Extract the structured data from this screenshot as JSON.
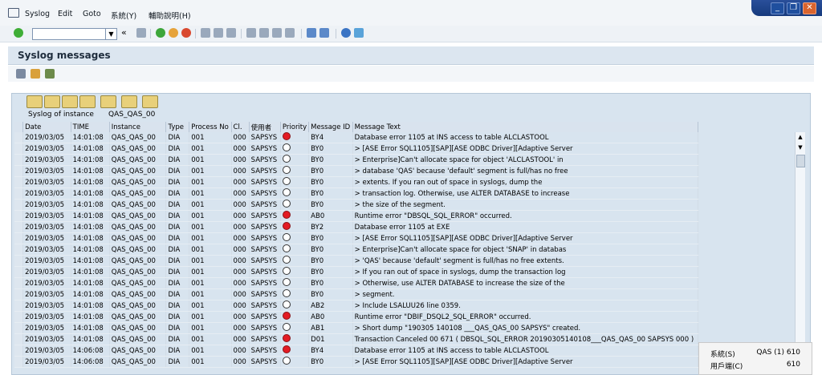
{
  "menu": {
    "items": [
      {
        "label": "Syslog"
      },
      {
        "label": "Edit"
      },
      {
        "label": "Goto"
      },
      {
        "label": "系統(Y)"
      },
      {
        "label": "輔助說明(H)"
      }
    ]
  },
  "window": {
    "minimize": "_",
    "restore": "❐",
    "close": "✕"
  },
  "toolbar": {
    "command_value": "",
    "back_symbol": "«"
  },
  "page": {
    "title": "Syslog messages"
  },
  "panel": {
    "instance_label": "Syslog of instance",
    "instance_value": "QAS_QAS_00"
  },
  "table": {
    "columns": [
      "Date",
      "TIME",
      "Instance",
      "Type",
      "Process No",
      "Cl.",
      "使用者",
      "Priority",
      "Message ID",
      "Message Text"
    ],
    "rows": [
      {
        "date": "2019/03/05",
        "time": "14:01:08",
        "instance": "QAS_QAS_00",
        "type": "DIA",
        "proc": "001",
        "cl": "000",
        "user": "SAPSYS",
        "priority": "red",
        "msgid": "BY4",
        "text": "Database error 1105 at INS access to table ALCLASTOOL"
      },
      {
        "date": "2019/03/05",
        "time": "14:01:08",
        "instance": "QAS_QAS_00",
        "type": "DIA",
        "proc": "001",
        "cl": "000",
        "user": "SAPSYS",
        "priority": "empty",
        "msgid": "BY0",
        "text": "> [ASE Error SQL1105][SAP][ASE ODBC Driver][Adaptive Server"
      },
      {
        "date": "2019/03/05",
        "time": "14:01:08",
        "instance": "QAS_QAS_00",
        "type": "DIA",
        "proc": "001",
        "cl": "000",
        "user": "SAPSYS",
        "priority": "empty",
        "msgid": "BY0",
        "text": "> Enterprise]Can't allocate space for object 'ALCLASTOOL' in"
      },
      {
        "date": "2019/03/05",
        "time": "14:01:08",
        "instance": "QAS_QAS_00",
        "type": "DIA",
        "proc": "001",
        "cl": "000",
        "user": "SAPSYS",
        "priority": "empty",
        "msgid": "BY0",
        "text": "> database 'QAS' because 'default' segment is full/has no free"
      },
      {
        "date": "2019/03/05",
        "time": "14:01:08",
        "instance": "QAS_QAS_00",
        "type": "DIA",
        "proc": "001",
        "cl": "000",
        "user": "SAPSYS",
        "priority": "empty",
        "msgid": "BY0",
        "text": "> extents. If you ran out of space in syslogs, dump the"
      },
      {
        "date": "2019/03/05",
        "time": "14:01:08",
        "instance": "QAS_QAS_00",
        "type": "DIA",
        "proc": "001",
        "cl": "000",
        "user": "SAPSYS",
        "priority": "empty",
        "msgid": "BY0",
        "text": "> transaction log. Otherwise, use ALTER DATABASE to increase"
      },
      {
        "date": "2019/03/05",
        "time": "14:01:08",
        "instance": "QAS_QAS_00",
        "type": "DIA",
        "proc": "001",
        "cl": "000",
        "user": "SAPSYS",
        "priority": "empty",
        "msgid": "BY0",
        "text": "> the size of the segment."
      },
      {
        "date": "2019/03/05",
        "time": "14:01:08",
        "instance": "QAS_QAS_00",
        "type": "DIA",
        "proc": "001",
        "cl": "000",
        "user": "SAPSYS",
        "priority": "red",
        "msgid": "AB0",
        "text": "Runtime error \"DBSQL_SQL_ERROR\" occurred."
      },
      {
        "date": "2019/03/05",
        "time": "14:01:08",
        "instance": "QAS_QAS_00",
        "type": "DIA",
        "proc": "001",
        "cl": "000",
        "user": "SAPSYS",
        "priority": "red",
        "msgid": "BY2",
        "text": "Database error 1105 at EXE"
      },
      {
        "date": "2019/03/05",
        "time": "14:01:08",
        "instance": "QAS_QAS_00",
        "type": "DIA",
        "proc": "001",
        "cl": "000",
        "user": "SAPSYS",
        "priority": "empty",
        "msgid": "BY0",
        "text": "> [ASE Error SQL1105][SAP][ASE ODBC Driver][Adaptive Server"
      },
      {
        "date": "2019/03/05",
        "time": "14:01:08",
        "instance": "QAS_QAS_00",
        "type": "DIA",
        "proc": "001",
        "cl": "000",
        "user": "SAPSYS",
        "priority": "empty",
        "msgid": "BY0",
        "text": "> Enterprise]Can't allocate space for object 'SNAP' in databas"
      },
      {
        "date": "2019/03/05",
        "time": "14:01:08",
        "instance": "QAS_QAS_00",
        "type": "DIA",
        "proc": "001",
        "cl": "000",
        "user": "SAPSYS",
        "priority": "empty",
        "msgid": "BY0",
        "text": "> 'QAS' because 'default' segment is full/has no free extents."
      },
      {
        "date": "2019/03/05",
        "time": "14:01:08",
        "instance": "QAS_QAS_00",
        "type": "DIA",
        "proc": "001",
        "cl": "000",
        "user": "SAPSYS",
        "priority": "empty",
        "msgid": "BY0",
        "text": "> If you ran out of space in syslogs, dump the transaction log"
      },
      {
        "date": "2019/03/05",
        "time": "14:01:08",
        "instance": "QAS_QAS_00",
        "type": "DIA",
        "proc": "001",
        "cl": "000",
        "user": "SAPSYS",
        "priority": "empty",
        "msgid": "BY0",
        "text": "> Otherwise, use ALTER DATABASE to increase the size of the"
      },
      {
        "date": "2019/03/05",
        "time": "14:01:08",
        "instance": "QAS_QAS_00",
        "type": "DIA",
        "proc": "001",
        "cl": "000",
        "user": "SAPSYS",
        "priority": "empty",
        "msgid": "BY0",
        "text": "> segment."
      },
      {
        "date": "2019/03/05",
        "time": "14:01:08",
        "instance": "QAS_QAS_00",
        "type": "DIA",
        "proc": "001",
        "cl": "000",
        "user": "SAPSYS",
        "priority": "empty",
        "msgid": "AB2",
        "text": "> Include LSALUU26 line 0359."
      },
      {
        "date": "2019/03/05",
        "time": "14:01:08",
        "instance": "QAS_QAS_00",
        "type": "DIA",
        "proc": "001",
        "cl": "000",
        "user": "SAPSYS",
        "priority": "red",
        "msgid": "AB0",
        "text": "Runtime error \"DBIF_DSQL2_SQL_ERROR\" occurred."
      },
      {
        "date": "2019/03/05",
        "time": "14:01:08",
        "instance": "QAS_QAS_00",
        "type": "DIA",
        "proc": "001",
        "cl": "000",
        "user": "SAPSYS",
        "priority": "empty",
        "msgid": "AB1",
        "text": "> Short dump \"190305 140108 ___QAS_QAS_00 SAPSYS\" created."
      },
      {
        "date": "2019/03/05",
        "time": "14:01:08",
        "instance": "QAS_QAS_00",
        "type": "DIA",
        "proc": "001",
        "cl": "000",
        "user": "SAPSYS",
        "priority": "red",
        "msgid": "D01",
        "text": "Transaction Canceled 00 671 ( DBSQL_SQL_ERROR 20190305140108___QAS_QAS_00 SAPSYS 000 )"
      },
      {
        "date": "2019/03/05",
        "time": "14:06:08",
        "instance": "QAS_QAS_00",
        "type": "DIA",
        "proc": "001",
        "cl": "000",
        "user": "SAPSYS",
        "priority": "red",
        "msgid": "BY4",
        "text": "Database error 1105 at INS access to table ALCLASTOOL"
      },
      {
        "date": "2019/03/05",
        "time": "14:06:08",
        "instance": "QAS_QAS_00",
        "type": "DIA",
        "proc": "001",
        "cl": "000",
        "user": "SAPSYS",
        "priority": "empty",
        "msgid": "BY0",
        "text": "> [ASE Error SQL1105][SAP][ASE ODBC Driver][Adaptive Server"
      }
    ]
  },
  "status": {
    "system_label": "系統(S)",
    "system_value": "QAS (1) 610",
    "client_label": "用戶端(C)",
    "client_value": "610"
  },
  "colors": {
    "header_bg": "#dce6f0",
    "panel_bg": "#d8e4ef",
    "priority_red": "#e31b23"
  },
  "icons": [
    "menu-icon",
    "check-icon",
    "save-icon",
    "back-icon",
    "exit-icon",
    "cancel-icon",
    "print-icon",
    "find-icon",
    "find-next-icon",
    "first-page-icon",
    "prev-page-icon",
    "next-page-icon",
    "last-page-icon",
    "new-session-icon",
    "shortcut-icon",
    "help-icon",
    "customize-icon",
    "refresh-icon",
    "layout-icon",
    "search-icon",
    "sort-asc-icon",
    "sort-desc-icon",
    "filter-icon",
    "sum-icon",
    "export-icon",
    "layout-select-icon"
  ]
}
